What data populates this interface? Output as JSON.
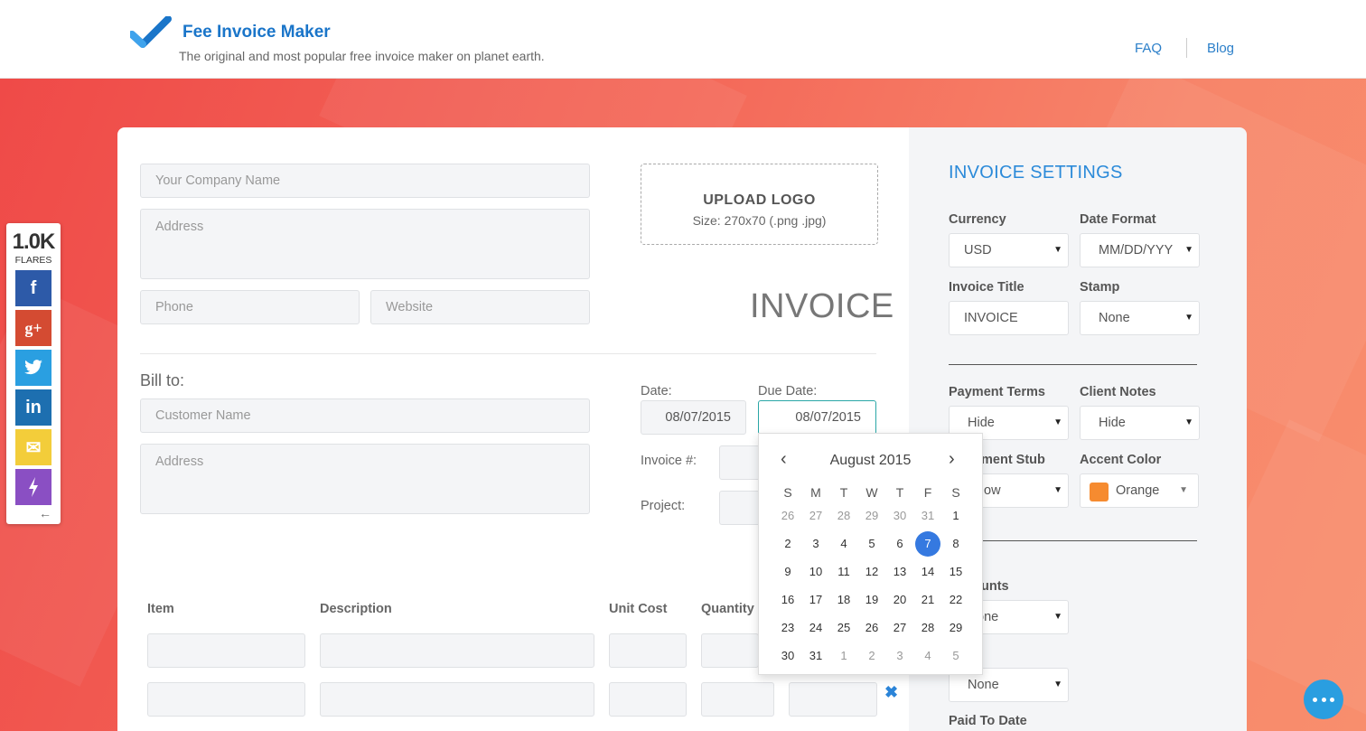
{
  "header": {
    "brand": "Fee Invoice Maker",
    "tagline": "The original and most popular free invoice maker on planet earth.",
    "nav": {
      "faq": "FAQ",
      "blog": "Blog"
    }
  },
  "share": {
    "count": "1.0K",
    "flares_label": "FLARES",
    "buttons": [
      {
        "icon": "facebook-icon",
        "glyph": "f",
        "color": "#2d5aa8"
      },
      {
        "icon": "google-plus-icon",
        "glyph": "g+",
        "color": "#d44b32"
      },
      {
        "icon": "twitter-icon",
        "glyph": "t",
        "color": "#2a9fe1"
      },
      {
        "icon": "linkedin-icon",
        "glyph": "in",
        "color": "#1d6fb0"
      },
      {
        "icon": "email-icon",
        "glyph": "✉",
        "color": "#f3cd3a"
      },
      {
        "icon": "flare-icon",
        "glyph": "⚡",
        "color": "#8a4fc3"
      }
    ]
  },
  "form": {
    "company_placeholder": "Your Company Name",
    "address_placeholder": "Address",
    "phone_placeholder": "Phone",
    "website_placeholder": "Website",
    "upload": {
      "title": "UPLOAD LOGO",
      "size": "Size: 270x70 (.png .jpg)"
    },
    "invoice_title": "INVOICE",
    "bill_to": "Bill to:",
    "customer_placeholder": "Customer Name",
    "customer_address_placeholder": "Address",
    "date_label": "Date:",
    "date_value": "08/07/2015",
    "due_date_label": "Due Date:",
    "due_date_value": "08/07/2015",
    "invoice_no_label": "Invoice #:",
    "project_label": "Project:",
    "columns": {
      "item": "Item",
      "description": "Description",
      "unit_cost": "Unit Cost",
      "quantity": "Quantity"
    },
    "remove_glyph": "✖"
  },
  "calendar": {
    "month_label": "August 2015",
    "prev": "‹",
    "next": "›",
    "dow": [
      "S",
      "M",
      "T",
      "W",
      "T",
      "F",
      "S"
    ],
    "weeks": [
      [
        "26",
        "27",
        "28",
        "29",
        "30",
        "31",
        "1"
      ],
      [
        "2",
        "3",
        "4",
        "5",
        "6",
        "7",
        "8"
      ],
      [
        "9",
        "10",
        "11",
        "12",
        "13",
        "14",
        "15"
      ],
      [
        "16",
        "17",
        "18",
        "19",
        "20",
        "21",
        "22"
      ],
      [
        "23",
        "24",
        "25",
        "26",
        "27",
        "28",
        "29"
      ],
      [
        "30",
        "31",
        "1",
        "2",
        "3",
        "4",
        "5"
      ]
    ],
    "selected_day": "7"
  },
  "settings": {
    "title": "INVOICE SETTINGS",
    "currency_label": "Currency",
    "currency_value": "USD",
    "date_format_label": "Date Format",
    "date_format_value": "MM/DD/YYY",
    "invoice_title_label": "Invoice Title",
    "invoice_title_value": "INVOICE",
    "stamp_label": "Stamp",
    "stamp_value": "None",
    "payment_terms_label": "Payment Terms",
    "payment_terms_value": "Hide",
    "client_notes_label": "Client Notes",
    "client_notes_value": "Hide",
    "payment_stub_label_visible": "ment Stub",
    "payment_stub_value_visible": "ow",
    "accent_color_label": "Accent Color",
    "accent_color_value": "Orange",
    "accent_color_hex": "#f68b30",
    "discounts_label_visible": "unts",
    "discounts_value_visible": "one",
    "select_value": "None",
    "paid_to_date_label": "Paid To Date",
    "caret": "▼"
  }
}
